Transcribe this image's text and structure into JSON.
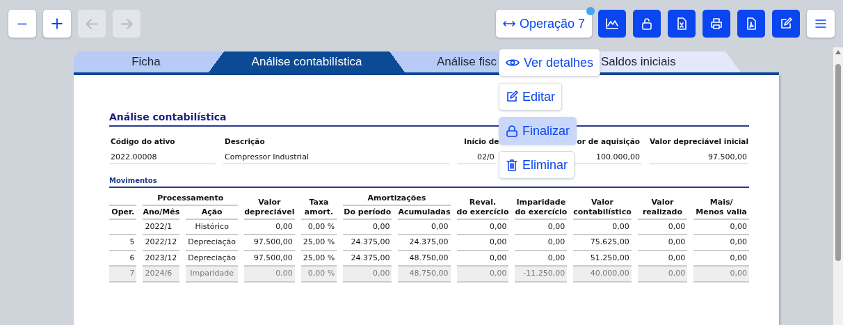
{
  "toolbar": {
    "left_buttons": [
      {
        "kind": "minus",
        "disabled": false
      },
      {
        "kind": "plus",
        "disabled": false
      },
      {
        "kind": "back",
        "disabled": true
      },
      {
        "kind": "forward",
        "disabled": true
      }
    ],
    "operation_button": {
      "label": "Operação 7",
      "notification": true
    },
    "right_buttons": [
      {
        "kind": "chart"
      },
      {
        "kind": "unlock"
      },
      {
        "kind": "excel"
      },
      {
        "kind": "print"
      },
      {
        "kind": "pdf"
      },
      {
        "kind": "edit"
      },
      {
        "kind": "menu"
      }
    ]
  },
  "tabs": [
    {
      "label": "Ficha",
      "selected": false
    },
    {
      "label": "Análise contabilística",
      "selected": true
    },
    {
      "label": "Análise fisc",
      "selected": false
    },
    {
      "label": "Saldos iniciais",
      "selected": false
    }
  ],
  "action_menu": [
    {
      "kind": "view",
      "label": "Ver detalhes",
      "highlighted": false
    },
    {
      "kind": "edit",
      "label": "Editar",
      "highlighted": false
    },
    {
      "kind": "lock",
      "label": "Finalizar",
      "highlighted": true
    },
    {
      "kind": "delete",
      "label": "Eliminar",
      "highlighted": false
    }
  ],
  "section_title": "Análise contabilística",
  "fields": [
    {
      "label": "Código do ativo",
      "value": "2022.00008"
    },
    {
      "label": "Descrição",
      "value": "Compressor Industrial"
    },
    {
      "label": "Início de",
      "value": "02/0"
    },
    {
      "label": "or de aquisição",
      "value": "100.000,00"
    },
    {
      "label": "Valor depreciável inicial",
      "value": "97.500,00"
    }
  ],
  "movements": {
    "title": "Movimentos",
    "header_groups": [
      "Processamento",
      "Amortizações"
    ],
    "columns": [
      "Oper.",
      "Ano/Mês",
      "Ação",
      "Valor\ndepreciável",
      "Taxa\namort.",
      "Do período",
      "Acumuladas",
      "Reval.\ndo exercício",
      "Imparidade\ndo exercício",
      "Valor\ncontabilístico",
      "Valor\nrealizado",
      "Mais/\nMenos valia"
    ],
    "rows": [
      {
        "muted": false,
        "cells": [
          "",
          "2022/1",
          "Histórico",
          "0,00",
          "0,00 %",
          "0,00",
          "0,00",
          "0,00",
          "0,00",
          "0,00",
          "0,00",
          "0,00"
        ]
      },
      {
        "muted": false,
        "cells": [
          "5",
          "2022/12",
          "Depreciação",
          "97.500,00",
          "25,00 %",
          "24.375,00",
          "24.375,00",
          "0,00",
          "0,00",
          "75.625,00",
          "0,00",
          "0,00"
        ]
      },
      {
        "muted": false,
        "cells": [
          "6",
          "2023/12",
          "Depreciação",
          "97.500,00",
          "25,00 %",
          "24.375,00",
          "48.750,00",
          "0,00",
          "0,00",
          "51.250,00",
          "0,00",
          "0,00"
        ]
      },
      {
        "muted": true,
        "cells": [
          "7",
          "2024/6",
          "Imparidade",
          "0,00",
          "0,00 %",
          "0,00",
          "48.750,00",
          "0,00",
          "-11.250,00",
          "40.000,00",
          "0,00",
          "0,00"
        ]
      }
    ]
  }
}
